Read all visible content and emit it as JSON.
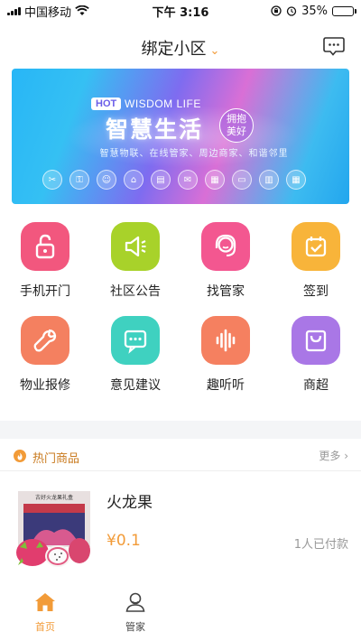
{
  "status_bar": {
    "carrier": "中国移动",
    "time": "下午 3:16",
    "battery": "35%",
    "battery_level": 0.35
  },
  "header": {
    "title": "绑定小区",
    "dropdown_glyph": "⌄",
    "message_icon": "chat-bubble-icon"
  },
  "banner": {
    "hot": "HOT",
    "tagline_en": "WISDOM LIFE",
    "headline": "智慧生活",
    "badge_line1": "拥抱",
    "badge_line2": "美好",
    "subtitle": "智慧物联、在线管家、周边商家、和谐邻里",
    "icons": [
      "tools-icon",
      "lock-icon",
      "people-icon",
      "home-icon",
      "doc-icon",
      "chat-icon",
      "calendar-icon",
      "monitor-icon",
      "shop-icon",
      "grid-icon"
    ]
  },
  "features": [
    {
      "label": "手机开门",
      "icon": "unlock-icon",
      "color": "#f2577e"
    },
    {
      "label": "社区公告",
      "icon": "megaphone-icon",
      "color": "#a8d22a"
    },
    {
      "label": "找管家",
      "icon": "headset-icon",
      "color": "#f35790"
    },
    {
      "label": "签到",
      "icon": "calendar-check-icon",
      "color": "#f8b43a"
    },
    {
      "label": "物业报修",
      "icon": "wrench-icon",
      "color": "#f48060"
    },
    {
      "label": "意见建议",
      "icon": "comment-icon",
      "color": "#3fd1c0"
    },
    {
      "label": "趣听听",
      "icon": "soundwave-icon",
      "color": "#f58060"
    },
    {
      "label": "商超",
      "icon": "shopping-bag-icon",
      "color": "#a977e6"
    }
  ],
  "hot_goods": {
    "title": "热门商品",
    "more": "更多",
    "more_arrow": "›",
    "product": {
      "box_text": "古好火龙果礼盒",
      "name": "火龙果",
      "price": "¥0.1",
      "sold": "1人已付款"
    }
  },
  "tabbar": {
    "items": [
      {
        "label": "首页",
        "icon": "home-icon",
        "active": true
      },
      {
        "label": "管家",
        "icon": "butler-icon",
        "active": false
      }
    ]
  },
  "colors": {
    "accent": "#f29b38",
    "muted": "#999999"
  }
}
